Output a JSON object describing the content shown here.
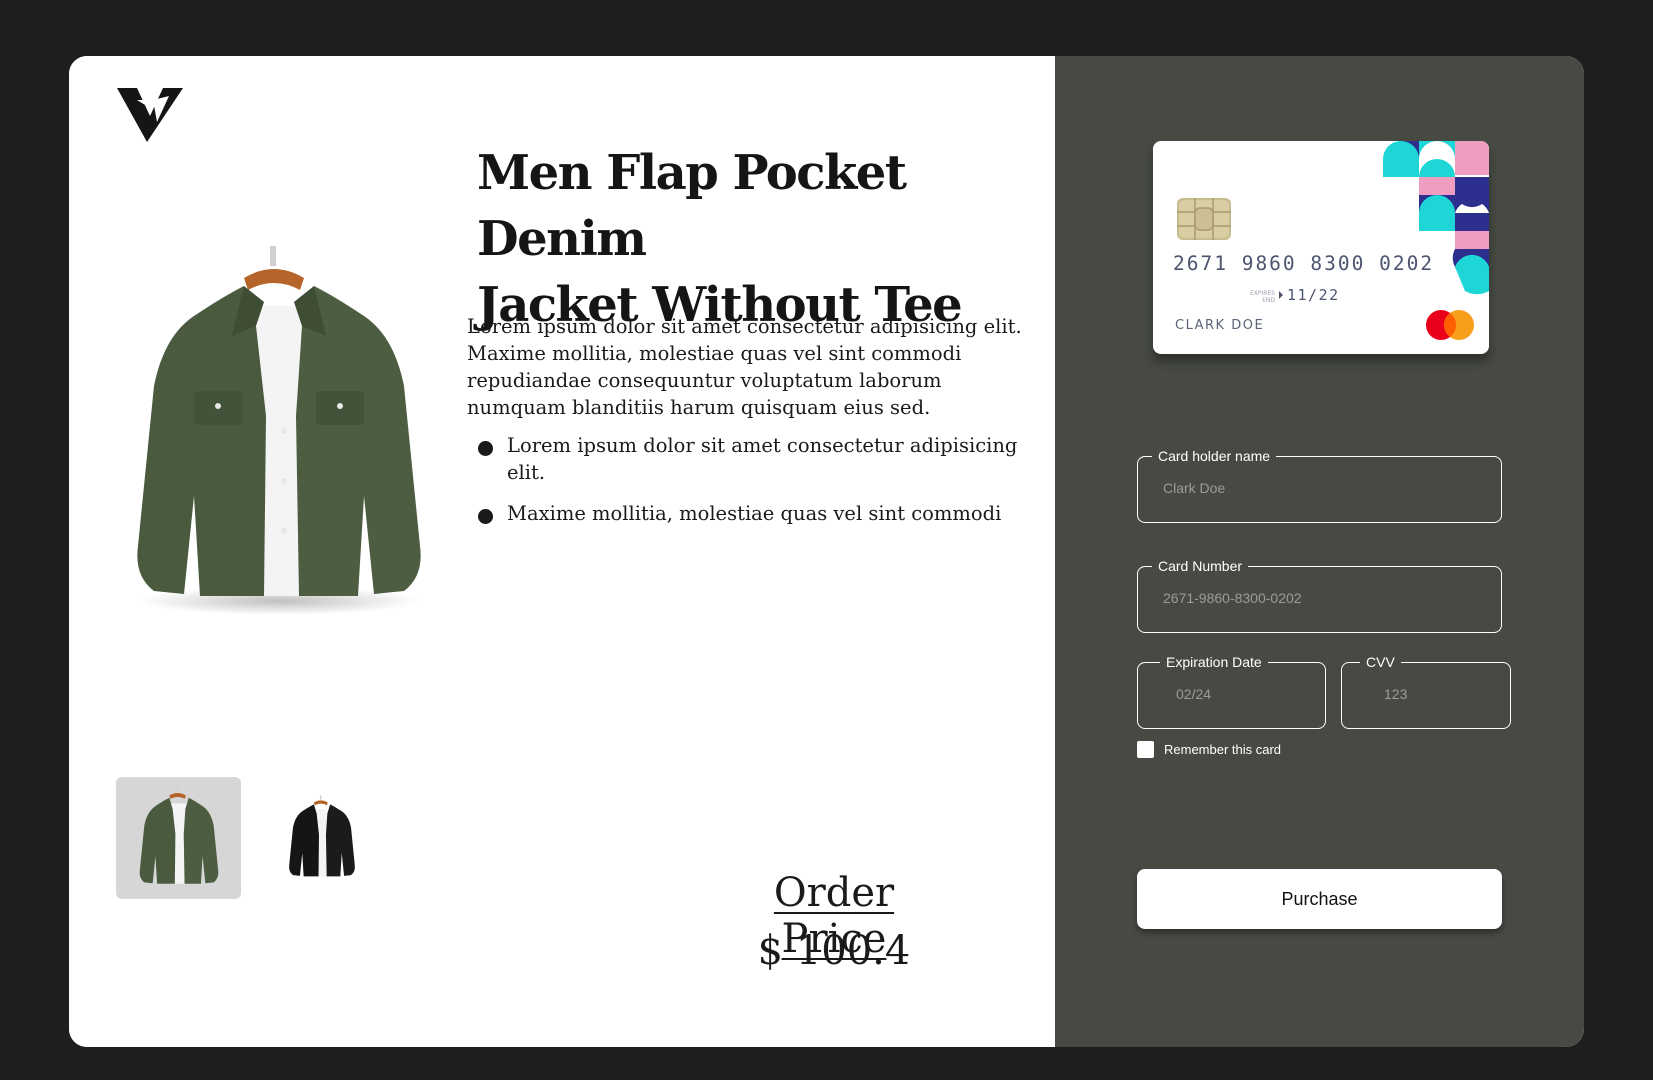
{
  "brand": {
    "logo_icon": "brand-monogram-icon"
  },
  "product": {
    "title_line1": "Men Flap Pocket Denim",
    "title_line2": "Jacket Without Tee",
    "description": "Lorem ipsum dolor sit amet consectetur adipisicing elit. Maxime mollitia, molestiae quas vel sint commodi repudiandae consequuntur voluptatum laborum numquam blanditiis harum quisquam eius sed.",
    "bullets": [
      "Lorem ipsum dolor sit amet consectetur adipisicing elit.",
      "Maxime mollitia, molestiae quas vel sint commodi"
    ],
    "thumbnails": [
      {
        "color": "green",
        "selected": true
      },
      {
        "color": "black",
        "selected": false
      }
    ]
  },
  "order": {
    "label": "Order Price",
    "price": "$ 100.4"
  },
  "card_preview": {
    "number": "2671 9860 8300 0202",
    "expires_label": "EXPIRES END",
    "expiry": "11/22",
    "holder": "CLARK DOE",
    "network_icon": "mastercard-icon"
  },
  "form": {
    "holder_label": "Card holder name",
    "holder_placeholder": "Clark Doe",
    "number_label": "Card Number",
    "number_placeholder": "2671-9860-8300-0202",
    "expiry_label": "Expiration Date",
    "expiry_placeholder": "02/24",
    "cvv_label": "CVV",
    "cvv_placeholder": "123",
    "remember_label": "Remember this card",
    "purchase_label": "Purchase"
  },
  "colors": {
    "page_bg": "#1e1e1e",
    "panel_bg": "#474a43",
    "card_teal": "#1ed6d6",
    "card_navy": "#2d2f8f",
    "card_pink": "#ef9dc1"
  }
}
